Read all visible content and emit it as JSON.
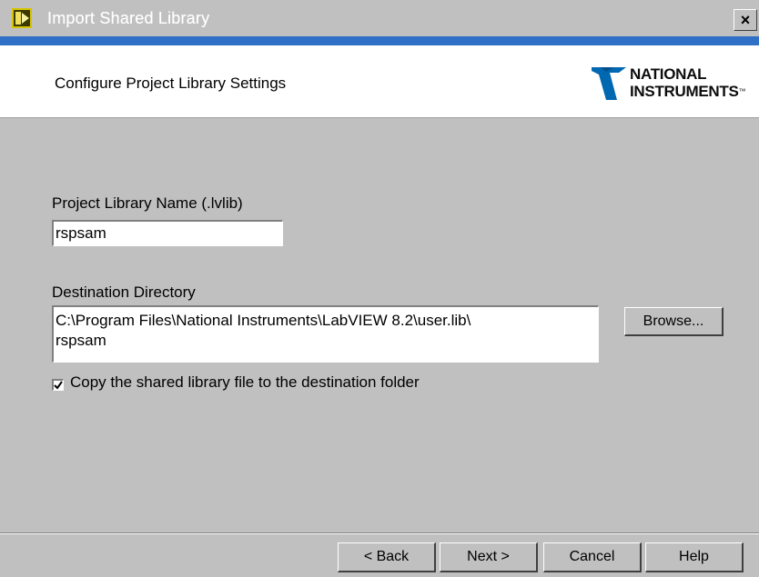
{
  "window": {
    "title": "Import Shared Library",
    "close_label": "×",
    "accent_color": "#2f6fc6"
  },
  "header": {
    "title": "Configure Project Library Settings",
    "logo_line1": "NATIONAL",
    "logo_line2": "INSTRUMENTS",
    "logo_tm": "™"
  },
  "form": {
    "library_name_label": "Project Library Name (.lvlib)",
    "library_name_value": "rspsam",
    "destination_label": "Destination Directory",
    "destination_value": "C:\\Program Files\\National Instruments\\LabVIEW 8.2\\user.lib\\\nrspsam",
    "browse_label": "Browse...",
    "copy_checked": true,
    "copy_label": "Copy the shared library file to the destination folder"
  },
  "footer": {
    "back_label": "< Back",
    "next_label": "Next >",
    "cancel_label": "Cancel",
    "help_label": "Help"
  },
  "icons": {
    "app_icon": "labview-app-icon",
    "close_icon": "close-icon",
    "check_icon": "checkmark-icon",
    "logo_icon": "ni-eagle-logo"
  }
}
